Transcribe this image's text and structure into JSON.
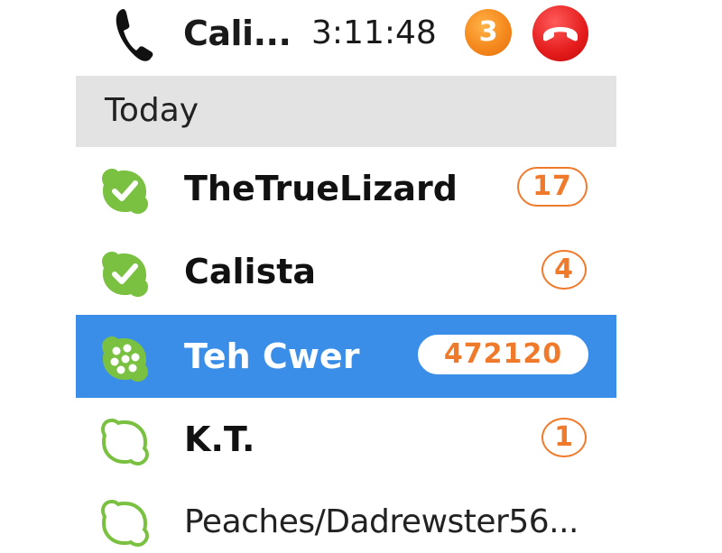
{
  "call": {
    "name": "Cali...",
    "timer": "3:11:48",
    "badge": "3",
    "icons": {
      "phone": "phone-icon",
      "hangup": "hangup-icon"
    },
    "colors": {
      "badge": "#f5891e",
      "hangup": "#e41b1b"
    }
  },
  "section": {
    "label": "Today"
  },
  "contacts": [
    {
      "name": "TheTrueLizard",
      "count": "17",
      "status": "online-icon"
    },
    {
      "name": "Calista",
      "count": "4",
      "status": "online-icon"
    },
    {
      "name": "Teh Cwer",
      "count": "472120",
      "status": "skype-status-icon",
      "selected": true
    },
    {
      "name": "K.T.",
      "count": "1",
      "status": "offline-icon"
    },
    {
      "name": "Peaches/Dadrewster56...",
      "count": "",
      "status": "offline-icon"
    }
  ],
  "colors": {
    "accent": "#3a8ee8",
    "badge_text": "#f07a2c",
    "status_green": "#7ac142"
  }
}
